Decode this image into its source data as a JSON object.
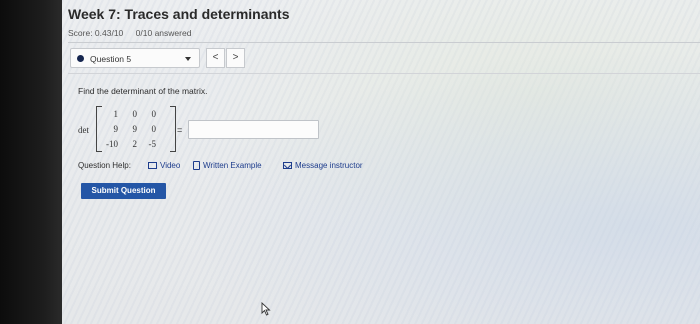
{
  "page": {
    "title": "Week 7: Traces and determinants",
    "score": "Score: 0.43/10",
    "answered": "0/10 answered"
  },
  "question_nav": {
    "selected": "Question 5",
    "prev_icon": "<",
    "next_icon": ">"
  },
  "question": {
    "prompt": "Find the determinant of the matrix.",
    "det_label": "det",
    "matrix": [
      [
        "1",
        "0",
        "0"
      ],
      [
        "9",
        "9",
        "0"
      ],
      [
        "-10",
        "2",
        "-5"
      ]
    ],
    "equals": "=",
    "answer_value": ""
  },
  "help": {
    "label": "Question Help:",
    "video": "Video",
    "written_example": "Written Example",
    "message_instructor": "Message instructor"
  },
  "submit_label": "Submit Question",
  "colors": {
    "accent": "#2456a6",
    "link": "#1d3c8c",
    "dot": "#16264f"
  },
  "icons": [
    "chevron-down-icon",
    "chevron-left-icon",
    "chevron-right-icon",
    "video-icon",
    "document-icon",
    "mail-icon",
    "mouse-cursor-icon"
  ]
}
